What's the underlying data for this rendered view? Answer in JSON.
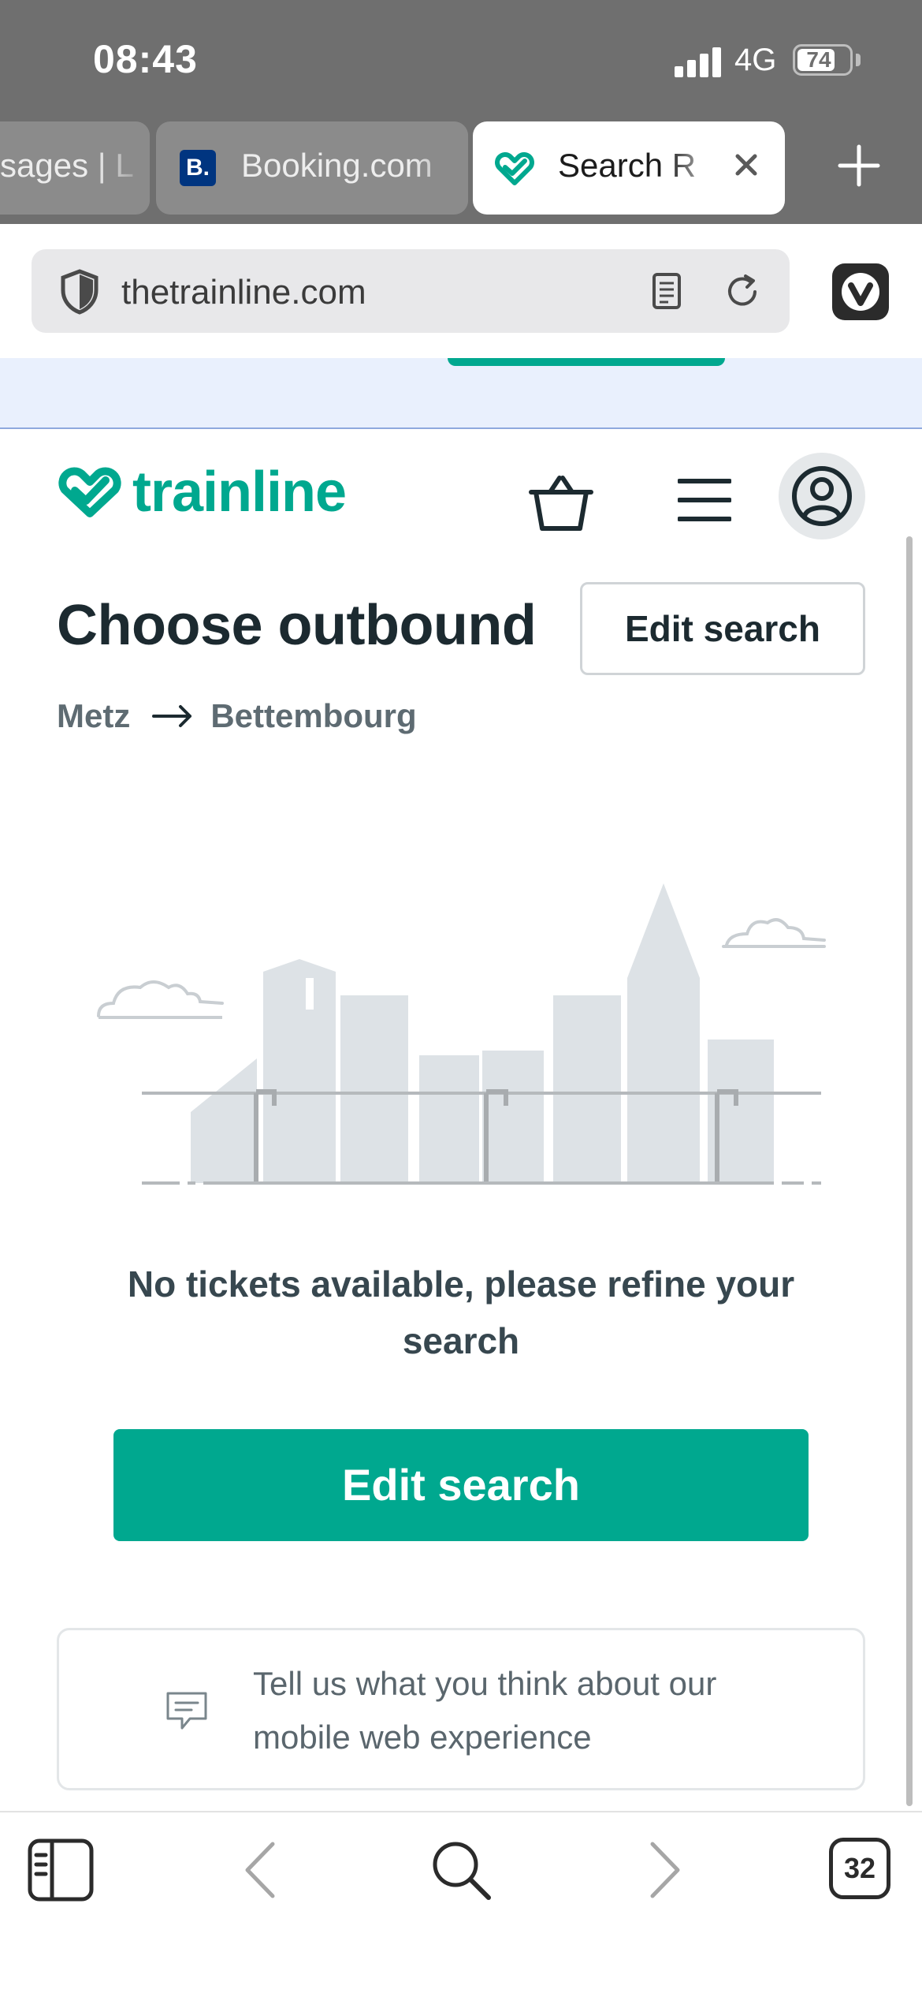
{
  "status_bar": {
    "time": "08:43",
    "network": "4G",
    "battery": "74",
    "battery_level_pct": 74
  },
  "tabs": [
    {
      "label": "sages | L",
      "active": false
    },
    {
      "label": "Booking.com",
      "icon": "B.",
      "active": false
    },
    {
      "label": "Search R",
      "icon": "trainline-heart-icon",
      "active": true
    }
  ],
  "address_bar": {
    "url": "thetrainline.com"
  },
  "header": {
    "logo_text": "trainline"
  },
  "page": {
    "title": "Choose outbound",
    "edit_search_top": "Edit search",
    "route": {
      "origin": "Metz",
      "destination": "Bettembourg"
    },
    "empty_message": "No tickets available, please refine your search",
    "edit_search_button": "Edit search",
    "feedback_text": "Tell us what you think about our mobile web experience"
  },
  "toolbar": {
    "tab_count": "32"
  },
  "colors": {
    "brand": "#00a88f",
    "text_dark": "#1c2a30",
    "chrome_gray": "#6f6f6f"
  }
}
